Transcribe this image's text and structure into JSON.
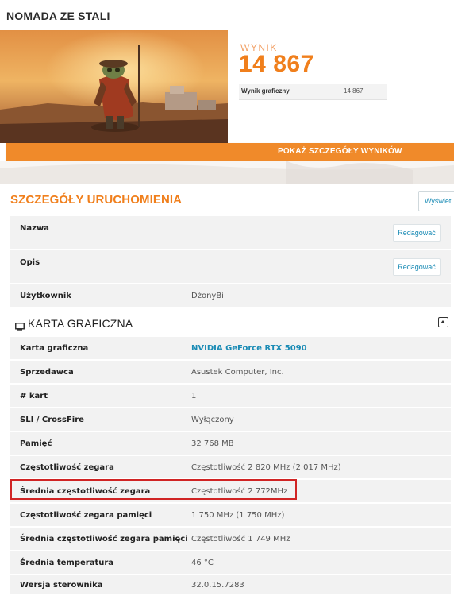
{
  "header": {
    "title": "NOMADA ZE STALI"
  },
  "score": {
    "label": "WYNIK",
    "value": "14 867",
    "sub_label": "Wynik graficzny",
    "sub_value": "14 867"
  },
  "result_bar": {
    "label": "POKAŻ SZCZEGÓŁY WYNIKÓW"
  },
  "details": {
    "title": "SZCZEGÓŁY URUCHOMIENIA",
    "show_button": "Wyświetl",
    "edit_label": "Redagować",
    "rows": [
      {
        "key": "Nazwa",
        "value": ""
      },
      {
        "key": "Opis",
        "value": ""
      },
      {
        "key": "Użytkownik",
        "value": "DżonyBi"
      }
    ]
  },
  "gpu": {
    "title": "KARTA GRAFICZNA",
    "rows": [
      {
        "key": "Karta graficzna",
        "value": "NVIDIA GeForce RTX 5090"
      },
      {
        "key": "Sprzedawca",
        "value": "Asustek Computer, Inc."
      },
      {
        "key": "# kart",
        "value": "1"
      },
      {
        "key": "SLI / CrossFire",
        "value": "Wyłączony"
      },
      {
        "key": "Pamięć",
        "value": "32 768 MB"
      },
      {
        "key": "Częstotliwość zegara",
        "value": "Częstotliwość 2 820 MHz (2 017 MHz)"
      },
      {
        "key": "Średnia częstotliwość zegara",
        "value": "Częstotliwość 2 772MHz"
      },
      {
        "key": "Częstotliwość zegara pamięci",
        "value": "1 750 MHz (1 750 MHz)"
      },
      {
        "key": "Średnia częstotliwość zegara pamięci",
        "value": "Częstotliwość 1 749 MHz"
      },
      {
        "key": "Średnia temperatura",
        "value": "46 °C"
      },
      {
        "key": "Wersja sterownika",
        "value": "32.0.15.7283"
      }
    ]
  },
  "colors": {
    "accent": "#f07f1c",
    "link": "#1a8bb5",
    "highlight": "#d02424"
  }
}
